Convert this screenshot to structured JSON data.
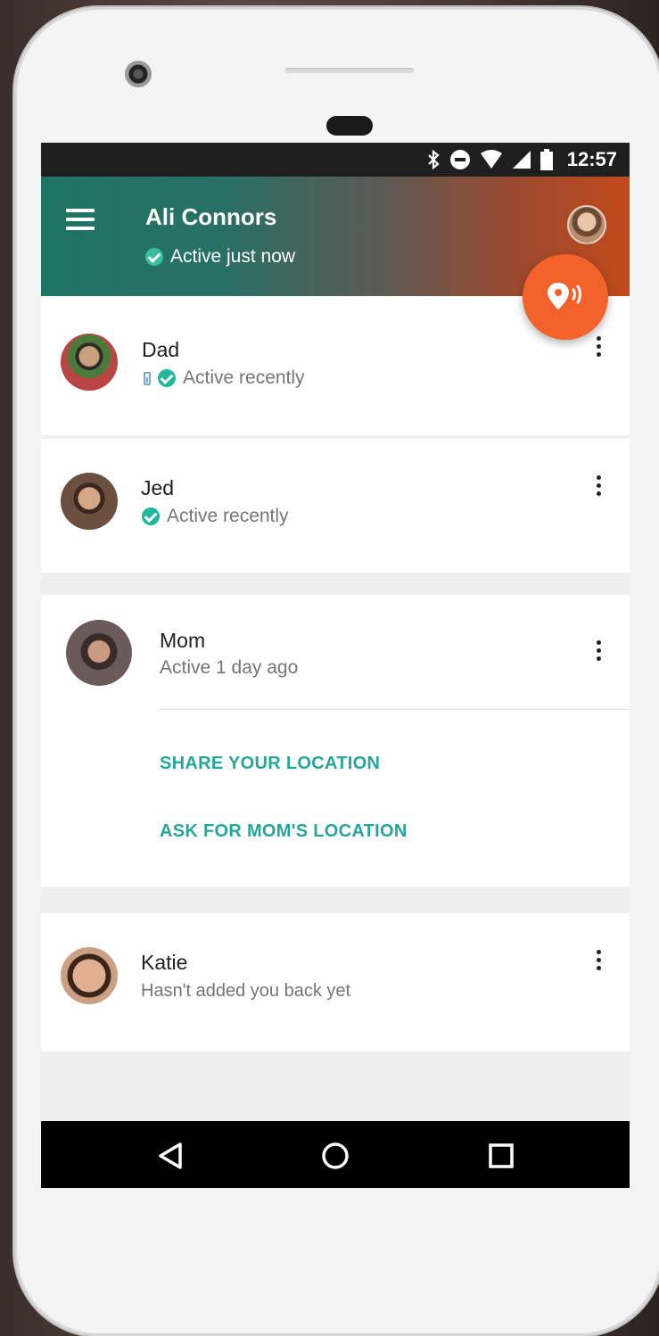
{
  "status_bar": {
    "time": "12:57"
  },
  "app_bar": {
    "title": "Ali Connors",
    "status": "Active just now"
  },
  "contacts": [
    {
      "name": "Dad",
      "status": "Active recently"
    },
    {
      "name": "Jed",
      "status": "Active recently"
    },
    {
      "name": "Mom",
      "status": "Active 1 day ago",
      "actions": [
        "SHARE YOUR LOCATION",
        "ASK FOR MOM'S LOCATION"
      ]
    },
    {
      "name": "Katie",
      "status": "Hasn't added you back yet"
    }
  ],
  "colors": {
    "accent": "#26a69a",
    "fab": "#f4622b",
    "check": "#1fb89a"
  },
  "icons": {
    "menu": "menu-icon",
    "fab": "location-share-icon",
    "more": "more-vert-icon",
    "nav_back": "back-triangle-icon",
    "nav_home": "home-circle-icon",
    "nav_recent": "recent-square-icon"
  }
}
